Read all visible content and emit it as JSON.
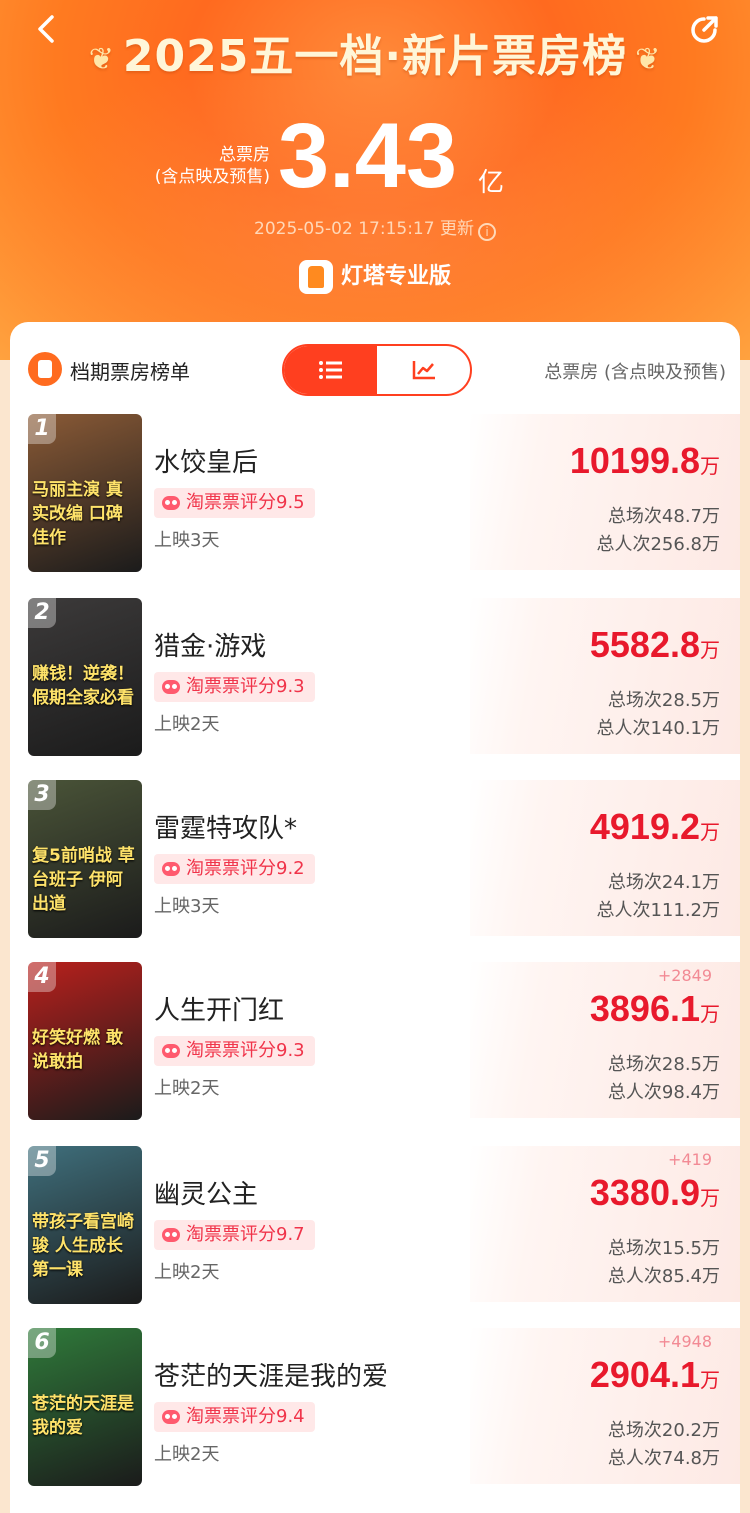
{
  "header": {
    "title": "2025五一档·新片票房榜",
    "total_label_1": "总票房",
    "total_label_2": "(含点映及预售)",
    "total_value": "3.43",
    "total_unit": "亿",
    "update_time": "2025-05-02 17:15:17 更新",
    "brand": "灯塔专业版",
    "back_icon": "back-icon",
    "share_icon": "share-icon"
  },
  "list": {
    "title": "档期票房榜单",
    "toggle": [
      {
        "icon": "list-icon",
        "active": true
      },
      {
        "icon": "trend-chart-icon",
        "active": false
      }
    ],
    "right_header": "总票房 (含点映及预售)",
    "movies": [
      {
        "rank": "1",
        "name": "水饺皇后",
        "score": "淘票票评分9.5",
        "days": "上映3天",
        "box": "10199.8",
        "unit": "万",
        "delta": "",
        "shows": "总场次48.7万",
        "people": "总人次256.8万",
        "poster_text": "马丽主演 真实改编 口碑佳作",
        "poster_color": "#8a5a36"
      },
      {
        "rank": "2",
        "name": "猎金·游戏",
        "score": "淘票票评分9.3",
        "days": "上映2天",
        "box": "5582.8",
        "unit": "万",
        "delta": "",
        "shows": "总场次28.5万",
        "people": "总人次140.1万",
        "poster_text": "赚钱！逆袭！ 假期全家必看",
        "poster_color": "#3c3a3a"
      },
      {
        "rank": "3",
        "name": "雷霆特攻队*",
        "score": "淘票票评分9.2",
        "days": "上映3天",
        "box": "4919.2",
        "unit": "万",
        "delta": "",
        "shows": "总场次24.1万",
        "people": "总人次111.2万",
        "poster_text": "复5前哨战 草台班子 伊阿出道",
        "poster_color": "#4a5438"
      },
      {
        "rank": "4",
        "name": "人生开门红",
        "score": "淘票票评分9.3",
        "days": "上映2天",
        "box": "3896.1",
        "unit": "万",
        "delta": "+2849",
        "shows": "总场次28.5万",
        "people": "总人次98.4万",
        "poster_text": "好笑好燃 敢说敢拍",
        "poster_color": "#b8201c"
      },
      {
        "rank": "5",
        "name": "幽灵公主",
        "score": "淘票票评分9.7",
        "days": "上映2天",
        "box": "3380.9",
        "unit": "万",
        "delta": "+419",
        "shows": "总场次15.5万",
        "people": "总人次85.4万",
        "poster_text": "带孩子看宫崎骏 人生成长第一课",
        "poster_color": "#3f6f7c"
      },
      {
        "rank": "6",
        "name": "苍茫的天涯是我的爱",
        "score": "淘票票评分9.4",
        "days": "上映2天",
        "box": "2904.1",
        "unit": "万",
        "delta": "+4948",
        "shows": "总场次20.2万",
        "people": "总人次74.8万",
        "poster_text": "苍茫的天涯是我的爱",
        "poster_color": "#2f7a3a"
      }
    ]
  },
  "colors": {
    "accent": "#ff3f1f",
    "box_red": "#e8192c",
    "hero": "#ff6a1f"
  }
}
